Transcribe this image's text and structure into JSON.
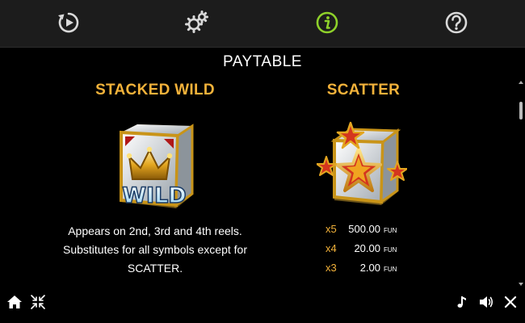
{
  "tabs": [
    {
      "icon": "replay-icon",
      "color": "#d9d9d9"
    },
    {
      "icon": "gears-icon",
      "color": "#d9d9d9"
    },
    {
      "icon": "info-icon",
      "color": "#8ed12a",
      "active": true
    },
    {
      "icon": "help-icon",
      "color": "#d9d9d9"
    }
  ],
  "page": {
    "title": "PAYTABLE"
  },
  "wild": {
    "title": "STACKED WILD",
    "image_label": "WILD",
    "description": [
      "Appears on 2nd, 3rd and 4th reels.",
      "Substitutes for all symbols except for",
      "SCATTER."
    ]
  },
  "scatter": {
    "title": "SCATTER",
    "pays": [
      {
        "mult": "x5",
        "amount": "500.00",
        "unit": "FUN"
      },
      {
        "mult": "x4",
        "amount": "20.00",
        "unit": "FUN"
      },
      {
        "mult": "x3",
        "amount": "2.00",
        "unit": "FUN"
      }
    ]
  },
  "colors": {
    "accent_gold": "#f3b23a",
    "active_tab": "#8ed12a",
    "topbar": "#1c1c1c"
  },
  "bottom_controls": [
    "home-icon",
    "shrink-icon",
    "music-icon",
    "sound-icon",
    "close-icon"
  ]
}
